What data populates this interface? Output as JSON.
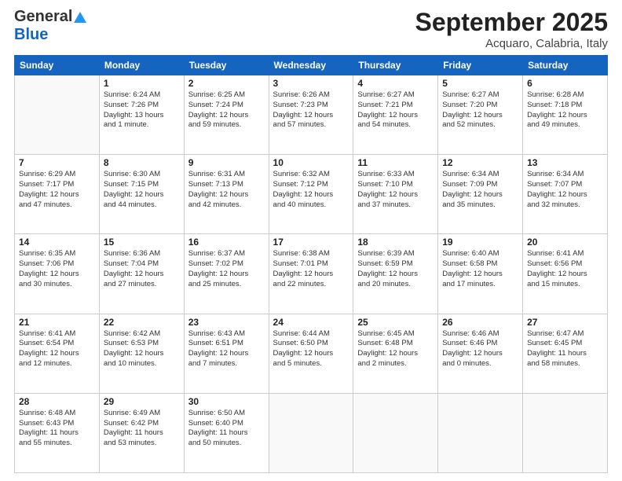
{
  "header": {
    "logo_general": "General",
    "logo_blue": "Blue",
    "title": "September 2025",
    "location": "Acquaro, Calabria, Italy"
  },
  "days_of_week": [
    "Sunday",
    "Monday",
    "Tuesday",
    "Wednesday",
    "Thursday",
    "Friday",
    "Saturday"
  ],
  "weeks": [
    [
      {
        "day": "",
        "info": ""
      },
      {
        "day": "1",
        "info": "Sunrise: 6:24 AM\nSunset: 7:26 PM\nDaylight: 13 hours\nand 1 minute."
      },
      {
        "day": "2",
        "info": "Sunrise: 6:25 AM\nSunset: 7:24 PM\nDaylight: 12 hours\nand 59 minutes."
      },
      {
        "day": "3",
        "info": "Sunrise: 6:26 AM\nSunset: 7:23 PM\nDaylight: 12 hours\nand 57 minutes."
      },
      {
        "day": "4",
        "info": "Sunrise: 6:27 AM\nSunset: 7:21 PM\nDaylight: 12 hours\nand 54 minutes."
      },
      {
        "day": "5",
        "info": "Sunrise: 6:27 AM\nSunset: 7:20 PM\nDaylight: 12 hours\nand 52 minutes."
      },
      {
        "day": "6",
        "info": "Sunrise: 6:28 AM\nSunset: 7:18 PM\nDaylight: 12 hours\nand 49 minutes."
      }
    ],
    [
      {
        "day": "7",
        "info": "Sunrise: 6:29 AM\nSunset: 7:17 PM\nDaylight: 12 hours\nand 47 minutes."
      },
      {
        "day": "8",
        "info": "Sunrise: 6:30 AM\nSunset: 7:15 PM\nDaylight: 12 hours\nand 44 minutes."
      },
      {
        "day": "9",
        "info": "Sunrise: 6:31 AM\nSunset: 7:13 PM\nDaylight: 12 hours\nand 42 minutes."
      },
      {
        "day": "10",
        "info": "Sunrise: 6:32 AM\nSunset: 7:12 PM\nDaylight: 12 hours\nand 40 minutes."
      },
      {
        "day": "11",
        "info": "Sunrise: 6:33 AM\nSunset: 7:10 PM\nDaylight: 12 hours\nand 37 minutes."
      },
      {
        "day": "12",
        "info": "Sunrise: 6:34 AM\nSunset: 7:09 PM\nDaylight: 12 hours\nand 35 minutes."
      },
      {
        "day": "13",
        "info": "Sunrise: 6:34 AM\nSunset: 7:07 PM\nDaylight: 12 hours\nand 32 minutes."
      }
    ],
    [
      {
        "day": "14",
        "info": "Sunrise: 6:35 AM\nSunset: 7:06 PM\nDaylight: 12 hours\nand 30 minutes."
      },
      {
        "day": "15",
        "info": "Sunrise: 6:36 AM\nSunset: 7:04 PM\nDaylight: 12 hours\nand 27 minutes."
      },
      {
        "day": "16",
        "info": "Sunrise: 6:37 AM\nSunset: 7:02 PM\nDaylight: 12 hours\nand 25 minutes."
      },
      {
        "day": "17",
        "info": "Sunrise: 6:38 AM\nSunset: 7:01 PM\nDaylight: 12 hours\nand 22 minutes."
      },
      {
        "day": "18",
        "info": "Sunrise: 6:39 AM\nSunset: 6:59 PM\nDaylight: 12 hours\nand 20 minutes."
      },
      {
        "day": "19",
        "info": "Sunrise: 6:40 AM\nSunset: 6:58 PM\nDaylight: 12 hours\nand 17 minutes."
      },
      {
        "day": "20",
        "info": "Sunrise: 6:41 AM\nSunset: 6:56 PM\nDaylight: 12 hours\nand 15 minutes."
      }
    ],
    [
      {
        "day": "21",
        "info": "Sunrise: 6:41 AM\nSunset: 6:54 PM\nDaylight: 12 hours\nand 12 minutes."
      },
      {
        "day": "22",
        "info": "Sunrise: 6:42 AM\nSunset: 6:53 PM\nDaylight: 12 hours\nand 10 minutes."
      },
      {
        "day": "23",
        "info": "Sunrise: 6:43 AM\nSunset: 6:51 PM\nDaylight: 12 hours\nand 7 minutes."
      },
      {
        "day": "24",
        "info": "Sunrise: 6:44 AM\nSunset: 6:50 PM\nDaylight: 12 hours\nand 5 minutes."
      },
      {
        "day": "25",
        "info": "Sunrise: 6:45 AM\nSunset: 6:48 PM\nDaylight: 12 hours\nand 2 minutes."
      },
      {
        "day": "26",
        "info": "Sunrise: 6:46 AM\nSunset: 6:46 PM\nDaylight: 12 hours\nand 0 minutes."
      },
      {
        "day": "27",
        "info": "Sunrise: 6:47 AM\nSunset: 6:45 PM\nDaylight: 11 hours\nand 58 minutes."
      }
    ],
    [
      {
        "day": "28",
        "info": "Sunrise: 6:48 AM\nSunset: 6:43 PM\nDaylight: 11 hours\nand 55 minutes."
      },
      {
        "day": "29",
        "info": "Sunrise: 6:49 AM\nSunset: 6:42 PM\nDaylight: 11 hours\nand 53 minutes."
      },
      {
        "day": "30",
        "info": "Sunrise: 6:50 AM\nSunset: 6:40 PM\nDaylight: 11 hours\nand 50 minutes."
      },
      {
        "day": "",
        "info": ""
      },
      {
        "day": "",
        "info": ""
      },
      {
        "day": "",
        "info": ""
      },
      {
        "day": "",
        "info": ""
      }
    ]
  ]
}
